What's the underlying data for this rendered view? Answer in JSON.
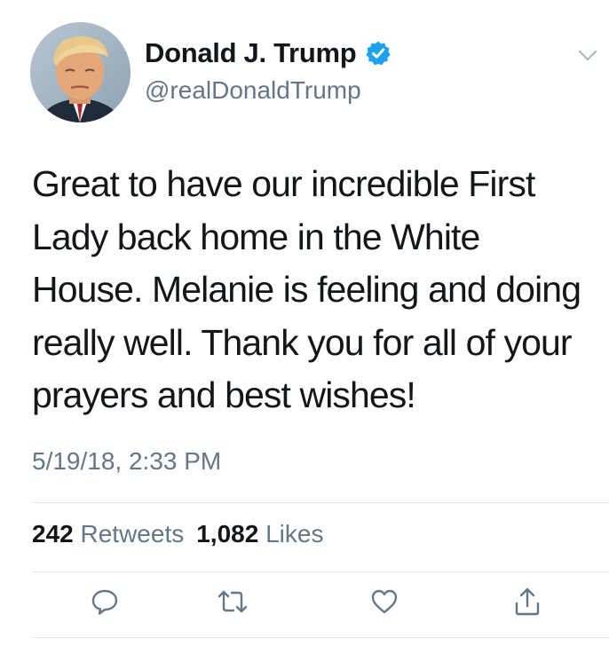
{
  "user": {
    "display_name": "Donald J. Trump",
    "handle": "@realDonaldTrump",
    "verified": true,
    "avatar": "avatar-photo"
  },
  "tweet": {
    "text": "Great to have our incredible First\nLady back home in the White\nHouse. Melanie is feeling and doing\nreally well. Thank you for all of your\nprayers and best wishes!",
    "timestamp": "5/19/18, 2:33 PM"
  },
  "stats": {
    "retweets_count": "242",
    "retweets_label": "Retweets",
    "likes_count": "1,082",
    "likes_label": "Likes"
  },
  "actions": [
    {
      "icon": "reply-icon"
    },
    {
      "icon": "retweet-icon"
    },
    {
      "icon": "like-icon"
    },
    {
      "icon": "share-icon"
    }
  ],
  "colors": {
    "verified": "#1da1f2",
    "secondary_text": "#657786",
    "primary_text": "#14171a",
    "divider": "#e1e8ed"
  }
}
